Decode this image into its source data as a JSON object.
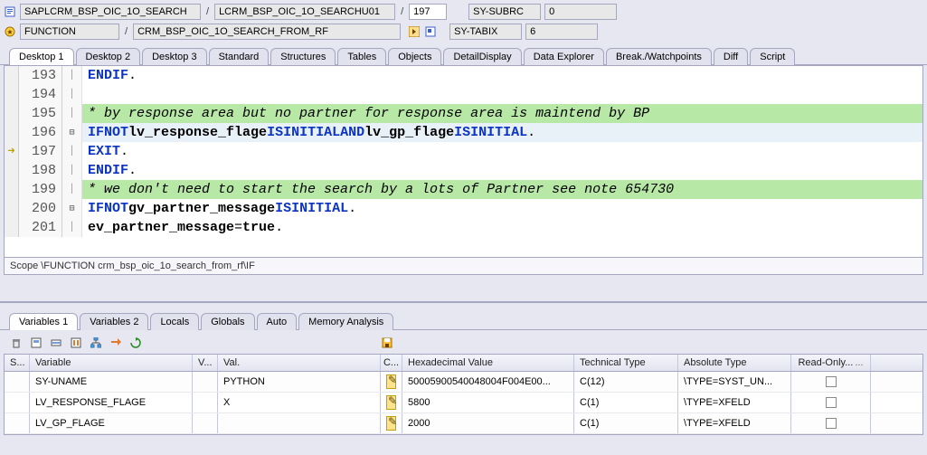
{
  "top": {
    "program": "SAPLCRM_BSP_OIC_1O_SEARCH",
    "include": "LCRM_BSP_OIC_1O_SEARCHU01",
    "line": "197",
    "sy_subrc_label": "SY-SUBRC",
    "sy_subrc_value": "0",
    "object_type": "FUNCTION",
    "object_name": "CRM_BSP_OIC_1O_SEARCH_FROM_RF",
    "sy_tabix_label": "SY-TABIX",
    "sy_tabix_value": "6"
  },
  "tabs": {
    "items": [
      "Desktop 1",
      "Desktop 2",
      "Desktop 3",
      "Standard",
      "Structures",
      "Tables",
      "Objects",
      "DetailDisplay",
      "Data Explorer",
      "Break./Watchpoints",
      "Diff",
      "Script"
    ],
    "active": 0
  },
  "code": {
    "lines": [
      {
        "n": 193,
        "html": "  <span class='kw'>ENDIF</span><span class='plain'>.</span>"
      },
      {
        "n": 194,
        "html": ""
      },
      {
        "n": 195,
        "comment": true,
        "html": "* by response area but no partner for response area is maintend by BP"
      },
      {
        "n": 196,
        "fold": "⊟",
        "hl": true,
        "html": "  <span class='kw'>IF</span> <span class='kw'>NOT</span> <span class='plain bold'>lv_response_flage</span> <span class='kw'>IS</span> <span class='kw'>INITIAL</span> <span class='kw'>AND</span> <span class='plain bold'>lv_gp_flage</span> <span class='kw'>IS</span> <span class='kw'>INITIAL</span><span class='plain'>.</span>"
      },
      {
        "n": 197,
        "marker": "arrow",
        "html": "    <span class='kw'>EXIT</span><span class='plain'>.</span>"
      },
      {
        "n": 198,
        "html": "  <span class='kw'>ENDIF</span><span class='plain'>.</span>"
      },
      {
        "n": 199,
        "comment": true,
        "html": "* we don't need to start the search by a lots of Partner see note 654730"
      },
      {
        "n": 200,
        "fold": "⊟",
        "html": "  <span class='kw'>IF</span> <span class='kw'>NOT</span> <span class='plain bold'>gv_partner_message</span>  <span class='kw'>IS</span> <span class='kw'>INITIAL</span><span class='plain'>.</span>"
      },
      {
        "n": 201,
        "html": "    <span class='plain bold'>ev_partner_message</span> <span class='plain'>=</span> <span class='plain bold'>true</span><span class='plain'>.</span>"
      }
    ]
  },
  "scope": "Scope \\FUNCTION crm_bsp_oic_1o_search_from_rf\\IF",
  "lower_tabs": {
    "items": [
      "Variables 1",
      "Variables 2",
      "Locals",
      "Globals",
      "Auto",
      "Memory Analysis"
    ],
    "active": 0
  },
  "grid": {
    "headers": {
      "sel": "S...",
      "var": "Variable",
      "vt": "V...",
      "val": "Val.",
      "ch": "C...",
      "hex": "Hexadecimal Value",
      "tt": "Technical Type",
      "at": "Absolute Type",
      "ro": "Read-Only..."
    },
    "rows": [
      {
        "var": "SY-UNAME",
        "val": "PYTHON",
        "hex": "50005900540048004F004E00...",
        "tt": "C(12)",
        "at": "\\TYPE=SYST_UN..."
      },
      {
        "var": "LV_RESPONSE_FLAGE",
        "val": "X",
        "hex": "5800",
        "tt": "C(1)",
        "at": "\\TYPE=XFELD"
      },
      {
        "var": "LV_GP_FLAGE",
        "val": "",
        "hex": "2000",
        "tt": "C(1)",
        "at": "\\TYPE=XFELD"
      }
    ]
  }
}
